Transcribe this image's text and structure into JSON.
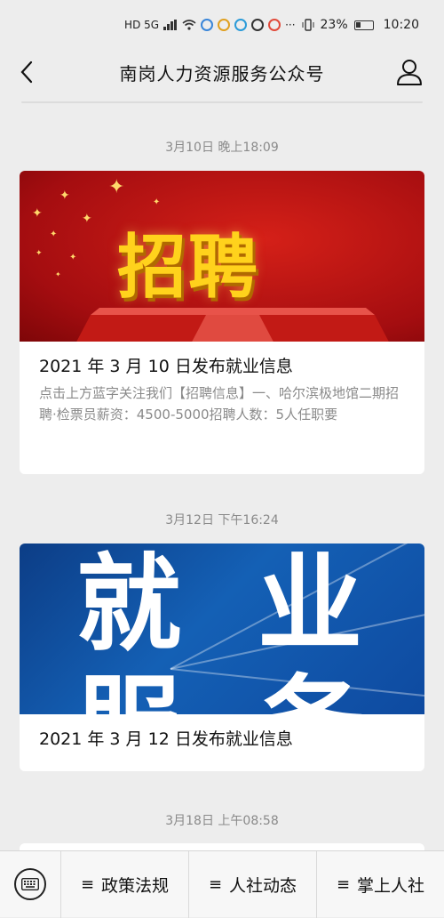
{
  "status_bar": {
    "network": "HD 5G",
    "battery": "23%",
    "time": "10:20",
    "more": "···"
  },
  "header": {
    "title": "南岗人力资源服务公众号",
    "back_icon": "chevron-left-icon",
    "profile_icon": "user-icon"
  },
  "feed": [
    {
      "time": "3月10日 晚上18:09",
      "banner_text": "招聘",
      "title": "2021 年 3 月 10 日发布就业信息",
      "desc": "点击上方蓝字关注我们【招聘信息】一、哈尔滨极地馆二期招聘·检票员薪资：4500-5000招聘人数：5人任职要"
    },
    {
      "time": "3月12日 下午16:24",
      "banner_chars": [
        "就",
        "业",
        "服",
        "务"
      ],
      "title": "2021 年 3 月 12 日发布就业信息"
    },
    {
      "time": "3月18日 上午08:58"
    }
  ],
  "bottom_menu": {
    "keyboard_icon": "keyboard-icon",
    "menu_icon": "≡",
    "items": [
      "政策法规",
      "人社动态",
      "掌上人社"
    ]
  }
}
